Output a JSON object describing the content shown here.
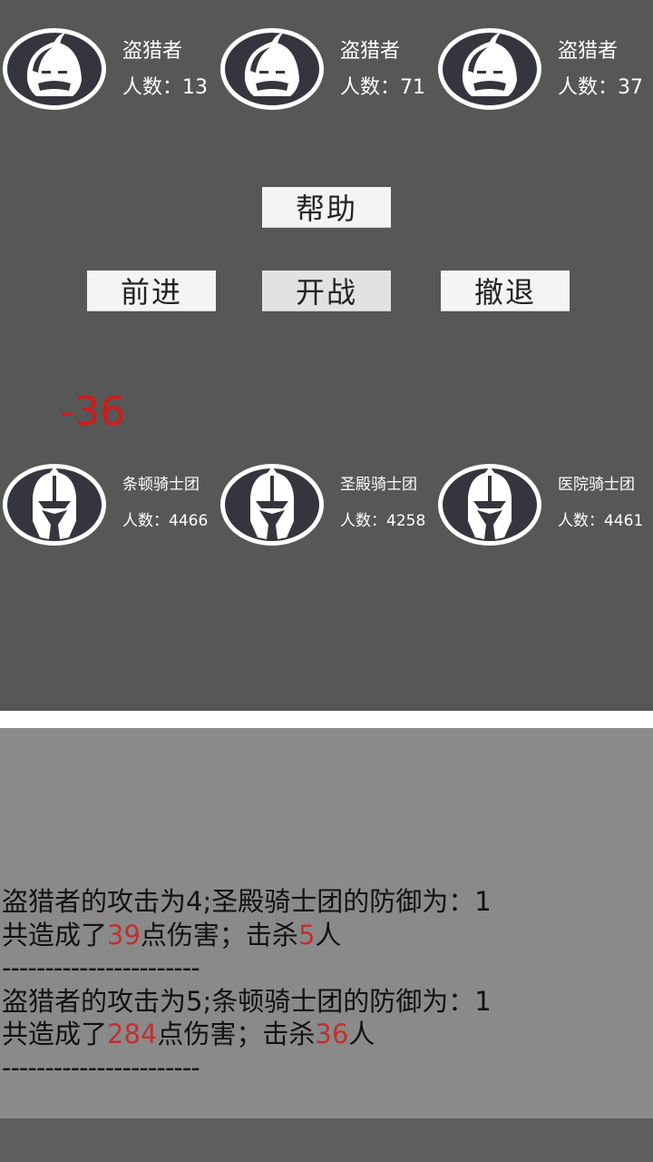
{
  "enemies": [
    {
      "name": "盗猎者",
      "count": "人数：13"
    },
    {
      "name": "盗猎者",
      "count": "人数：71"
    },
    {
      "name": "盗猎者",
      "count": "人数：37"
    }
  ],
  "buttons": {
    "help": "帮助",
    "advance": "前进",
    "fight": "开战",
    "retreat": "撤退"
  },
  "damage_popup": "-36",
  "allies": [
    {
      "name": "条顿骑士团",
      "count": "人数：4466"
    },
    {
      "name": "圣殿骑士团",
      "count": "人数：4258"
    },
    {
      "name": "医院骑士团",
      "count": "人数：4461"
    }
  ],
  "battle_log": [
    {
      "attack_line": "盗猎者的攻击为4;圣殿骑士团的防御为：1",
      "result_prefix": "共造成了",
      "damage": "39",
      "result_mid": "点伤害；击杀",
      "kills": "5",
      "result_suffix": "人",
      "separator": "-----------------------"
    },
    {
      "attack_line": "盗猎者的攻击为5;条顿骑士团的防御为：1",
      "result_prefix": "共造成了",
      "damage": "284",
      "result_mid": "点伤害；击杀",
      "kills": "36",
      "result_suffix": "人",
      "separator": "-----------------------"
    }
  ],
  "colors": {
    "highlight": "#c0312f",
    "damage_popup": "#d21a1a",
    "battle_bg": "#575757",
    "log_bg": "#8a8a8a"
  },
  "icons": {
    "enemy": "hooded-bandit-icon",
    "ally": "knight-helmet-icon"
  }
}
